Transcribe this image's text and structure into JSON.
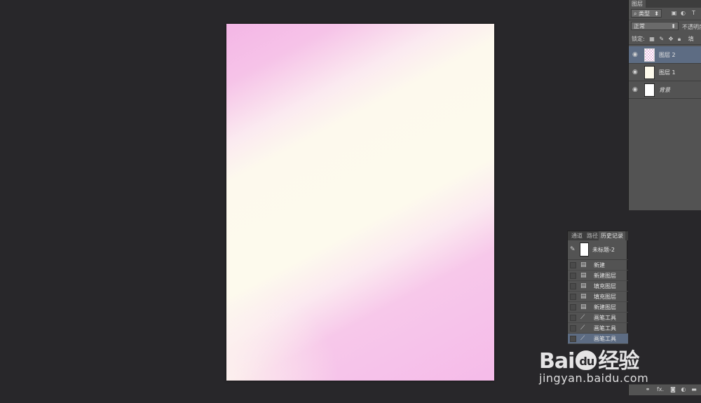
{
  "layers_panel": {
    "tab": "图层",
    "filter_kind": "类型",
    "blend_mode": "正常",
    "opacity_label": "不透明度",
    "lock_label": "锁定:",
    "fill_label": "填",
    "layers": [
      {
        "name": "图层 2",
        "selected": true
      },
      {
        "name": "图层 1",
        "selected": false
      },
      {
        "name": "背景",
        "selected": false
      }
    ],
    "footer_fx": "fx."
  },
  "history_panel": {
    "tabs": [
      "通道",
      "路径",
      "历史记录"
    ],
    "active_tab": "历史记录",
    "snapshot": "未标题-2",
    "items": [
      {
        "label": "新建",
        "icon": "document-icon",
        "selected": false
      },
      {
        "label": "新建图层",
        "icon": "document-icon",
        "selected": false
      },
      {
        "label": "填充图层",
        "icon": "document-icon",
        "selected": false
      },
      {
        "label": "填充图层",
        "icon": "document-icon",
        "selected": false
      },
      {
        "label": "新建图层",
        "icon": "document-icon",
        "selected": false
      },
      {
        "label": "画笔工具",
        "icon": "brush-icon",
        "selected": false
      },
      {
        "label": "画笔工具",
        "icon": "brush-icon",
        "selected": false
      },
      {
        "label": "画笔工具",
        "icon": "brush-icon",
        "selected": true
      }
    ]
  },
  "watermark": {
    "logo_left": "Bai",
    "logo_paw": "du",
    "logo_right": "经验",
    "url": "jingyan.baidu.com"
  },
  "colors": {
    "workspace": "#28272a",
    "panel": "#535353",
    "selection": "#5d6c83",
    "canvas_pink": "#f4b6e6",
    "canvas_cream": "#fdfaed"
  }
}
